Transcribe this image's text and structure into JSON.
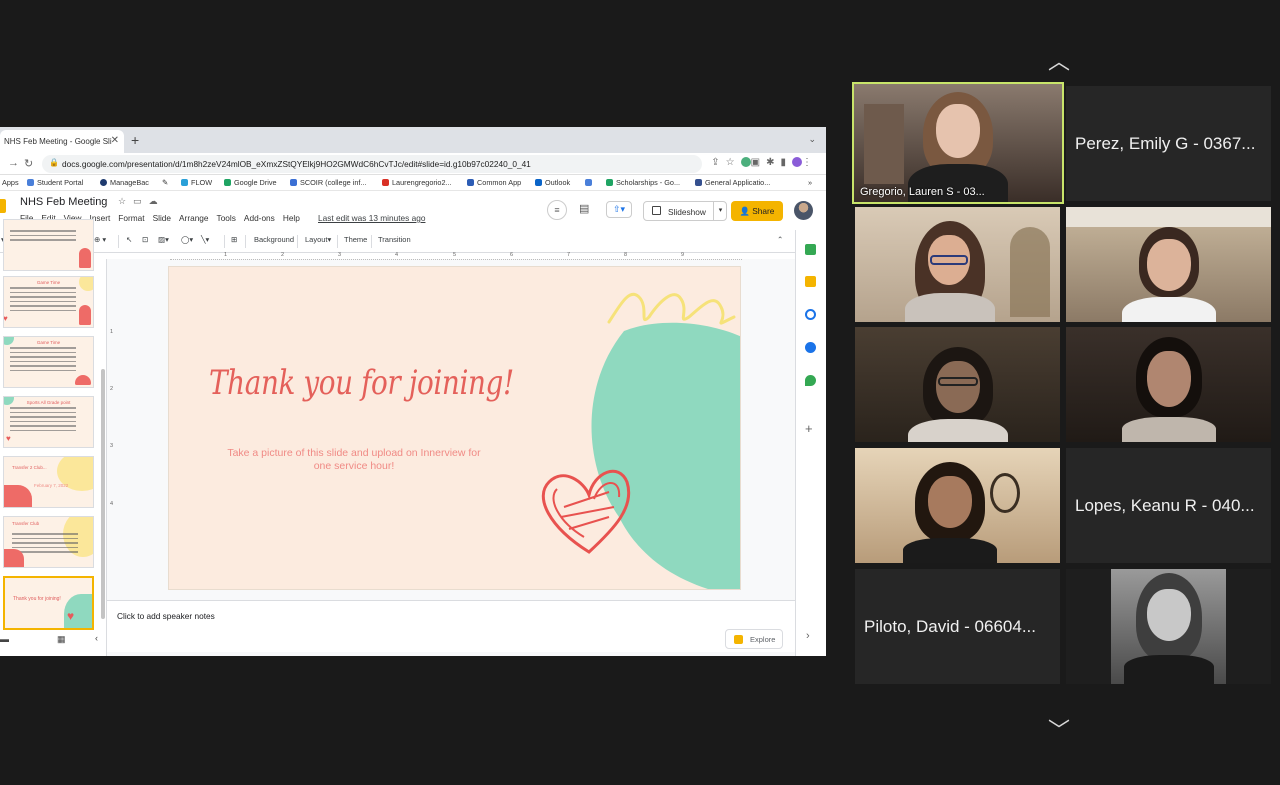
{
  "browser": {
    "tab_title": "NHS Feb Meeting - Google Sli",
    "url": "docs.google.com/presentation/d/1m8h2zeV24mlOB_eXmxZStQYElkj9HO2GMWdC6hCvTJc/edit#slide=id.g10b97c02240_0_41",
    "bookmarks": [
      "Apps",
      "Student Portal",
      "ManageBac",
      "FLOW",
      "Google Drive",
      "SCOIR (college inf...",
      "Laurengregorio2...",
      "Common App",
      "Outlook",
      "Scholarships - Go...",
      "General Applicatio..."
    ]
  },
  "slides_app": {
    "doc_title": "NHS Feb Meeting",
    "menu": [
      "File",
      "Edit",
      "View",
      "Insert",
      "Format",
      "Slide",
      "Arrange",
      "Tools",
      "Add-ons",
      "Help"
    ],
    "last_edit": "Last edit was 13 minutes ago",
    "slideshow_label": "Slideshow",
    "share_label": "Share",
    "toolbar": {
      "background": "Background",
      "layout": "Layout",
      "theme": "Theme",
      "transition": "Transition"
    },
    "ruler_marks": [
      "1",
      "2",
      "3",
      "4",
      "5",
      "6",
      "7",
      "8",
      "9"
    ],
    "thumbnails": [
      {
        "title": ""
      },
      {
        "title": "Game Time"
      },
      {
        "title": "Game Time"
      },
      {
        "title": "Sports All Grade point"
      },
      {
        "title": "Transfer 2 Club...",
        "subtitle": "February 7, 2022"
      },
      {
        "title": "Transfer Club"
      },
      {
        "title": "Thank you for joining!"
      }
    ],
    "slide": {
      "title": "Thank you for joining!",
      "subtitle": "Take a picture of this slide and upload on Innerview for one service hour!"
    },
    "notes_placeholder": "Click to add speaker notes",
    "explore_label": "Explore"
  },
  "gallery": {
    "participants": [
      {
        "name": "Gregorio, Lauren S - 03...",
        "video": true,
        "active": true
      },
      {
        "name": "Perez, Emily G - 0367...",
        "video": false
      },
      {
        "name": "",
        "video": true
      },
      {
        "name": "",
        "video": true
      },
      {
        "name": "",
        "video": true
      },
      {
        "name": "",
        "video": true
      },
      {
        "name": "",
        "video": true
      },
      {
        "name": "Lopes, Keanu R - 040...",
        "video": false
      },
      {
        "name": "Piloto, David - 06604...",
        "video": false
      },
      {
        "name": "",
        "video": true
      }
    ]
  },
  "colors": {
    "slide_bg": "#fcebdf",
    "title_red": "#e4605a",
    "mint": "#8fd9bf",
    "yellow": "#fbe79a",
    "share_yellow": "#f4b400",
    "active_speaker": "#c8e46a"
  }
}
